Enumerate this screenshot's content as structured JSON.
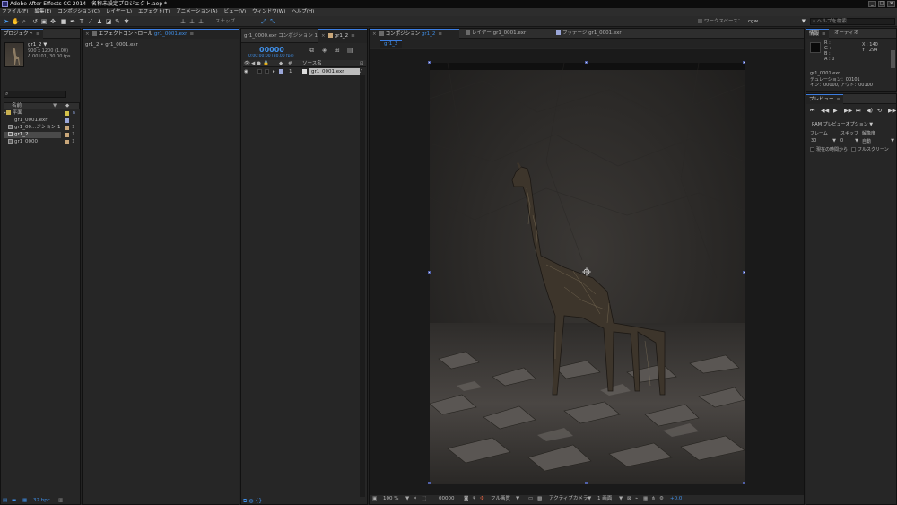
{
  "app": {
    "title": "Adobe After Effects CC 2014 - 名称未設定プロジェクト.aep *",
    "window_buttons": [
      "_",
      "□",
      "✕"
    ]
  },
  "menu": [
    "ファイル(F)",
    "編集(E)",
    "コンポジション(C)",
    "レイヤー(L)",
    "エフェクト(T)",
    "アニメーション(A)",
    "ビュー(V)",
    "ウィンドウ(W)",
    "ヘルプ(H)"
  ],
  "toolbar": {
    "snap_label": "スナップ",
    "workspace_label": "ワークスペース：",
    "workspace_value": "cgw",
    "help_search_placeholder": "ヘルプを検索"
  },
  "project": {
    "tab": "プロジェクト",
    "item_name": "gr1_2 ▼",
    "item_dims": "900 x 1200 (1.00)",
    "item_duration": "Δ 00101, 30.00 fps",
    "search_icon": "search-icon",
    "column_name": "名前",
    "items": [
      {
        "name": "平面",
        "type": "folder",
        "color": "#d4c24a"
      },
      {
        "name": "gr1_0001.exr",
        "type": "footage",
        "color": "#9aa6d8"
      },
      {
        "name": "gr1_00...ジション 1",
        "type": "comp",
        "color": "#c9a77a"
      },
      {
        "name": "gr1_2",
        "type": "comp",
        "color": "#c9a77a"
      },
      {
        "name": "gr1_0000",
        "type": "comp",
        "color": "#c9a77a"
      }
    ],
    "bpc": "32 bpc"
  },
  "effect_controls": {
    "tab": "エフェクトコントロール",
    "tab_target": "gr1_0001.exr",
    "breadcrumb": "gr1_2 • gr1_0001.exr"
  },
  "timeline": {
    "tab_inactive": "gr1_0000.exr コンポジション 1",
    "tab_active": "gr1_2",
    "timecode": "00000",
    "timecode_sub": "0:00:00:00 (30.00 fps)",
    "col_num": "#",
    "col_source": "ソース名",
    "layer_num": "1",
    "layer_name": "gr1_0001.exr"
  },
  "composition": {
    "tab_comp": "コンポジション",
    "tab_comp_name": "gr1_2",
    "tab_layer": "レイヤー",
    "tab_layer_name": "gr1_0001.exr",
    "tab_footage": "フッテージ",
    "tab_footage_name": "gr1_0001.exr",
    "subtab": "gr1_2",
    "zoom": "100 %",
    "frame": "00000",
    "resolution": "フル画質",
    "camera": "アクティブカメラ",
    "views": "1 画面",
    "exposure": "+0.0"
  },
  "info": {
    "tab_info": "情報",
    "tab_audio": "オーディオ",
    "r": "R :",
    "g": "G :",
    "b": "B :",
    "a": "A : 0",
    "x": "X : 140",
    "y": "Y : 294",
    "file": "gr1_0001.exr",
    "duration": "デュレーション：00101",
    "in_out": "イン：00000, アウト：00100"
  },
  "preview": {
    "tab": "プレビュー",
    "ram_option": "RAM プレビューオプション",
    "frame_label": "フレーム",
    "skip_label": "スキップ",
    "resolution_label": "解像度",
    "frame_value": "30",
    "skip_value": "0",
    "resolution_value": "自動",
    "from_current": "現在の時間から",
    "fullscreen": "フルスクリーン"
  },
  "colors": {
    "accent": "#3f8fe8",
    "panel_bg": "#262626",
    "viewer_bg": "#1a1a1a",
    "label_yellow": "#d4c24a",
    "label_footage": "#9aa6d8"
  }
}
